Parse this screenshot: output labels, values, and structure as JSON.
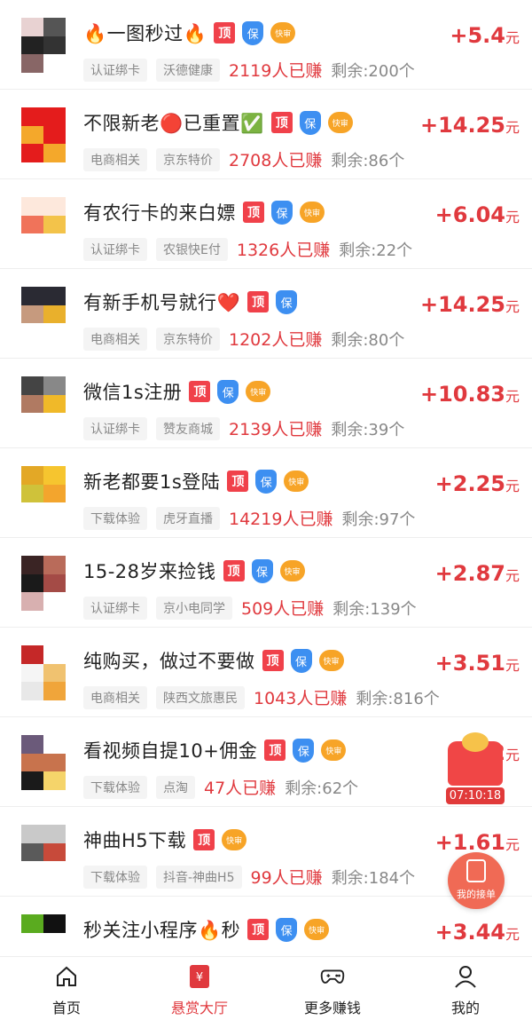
{
  "tasks": [
    {
      "title": "🔥一图秒过🔥",
      "badges": [
        "top",
        "bao",
        "fast"
      ],
      "tag1": "认证绑卡",
      "tag2": "沃德健康",
      "earned": "2119人已赚",
      "remain": "剩余:200个",
      "price": "+5.4",
      "thumb": [
        "#e8d2d2",
        "#555",
        "#222",
        "#333",
        "#866",
        "#fff"
      ]
    },
    {
      "title": "不限新老🔴已重置✅",
      "badges": [
        "top",
        "bao",
        "fast"
      ],
      "tag1": "电商相关",
      "tag2": "京东特价",
      "earned": "2708人已赚",
      "remain": "剩余:86个",
      "price": "+14.25",
      "thumb": [
        "#e41c1c",
        "#e41c1c",
        "#f4a82b",
        "#e41c1c",
        "#e41c1c",
        "#f4a82b"
      ]
    },
    {
      "title": "有农行卡的来白嫖",
      "badges": [
        "top",
        "bao",
        "fast"
      ],
      "tag1": "认证绑卡",
      "tag2": "农银快E付",
      "earned": "1326人已赚",
      "remain": "剩余:22个",
      "price": "+6.04",
      "thumb": [
        "#fde8dc",
        "#fde8dc",
        "#f0735a",
        "#f3c34a",
        "#fff",
        "#fff"
      ]
    },
    {
      "title": "有新手机号就行❤️",
      "badges": [
        "top",
        "bao"
      ],
      "tag1": "电商相关",
      "tag2": "京东特价",
      "earned": "1202人已赚",
      "remain": "剩余:80个",
      "price": "+14.25",
      "thumb": [
        "#2a2a33",
        "#2a2a33",
        "#c69a7e",
        "#e9b02c",
        "#fff",
        "#fff"
      ]
    },
    {
      "title": "微信1s注册",
      "badges": [
        "top",
        "bao",
        "fast"
      ],
      "tag1": "认证绑卡",
      "tag2": "赞友商城",
      "earned": "2139人已赚",
      "remain": "剩余:39个",
      "price": "+10.83",
      "thumb": [
        "#444",
        "#888",
        "#b07a62",
        "#f0b929",
        "#fff",
        "#fff"
      ]
    },
    {
      "title": "新老都要1s登陆",
      "badges": [
        "top",
        "bao",
        "fast"
      ],
      "tag1": "下载体验",
      "tag2": "虎牙直播",
      "earned": "14219人已赚",
      "remain": "剩余:97个",
      "price": "+2.25",
      "thumb": [
        "#e3a826",
        "#f6c52f",
        "#cfc23a",
        "#f3a52d",
        "#fff",
        "#fff"
      ]
    },
    {
      "title": "15-28岁来捡钱",
      "badges": [
        "top",
        "bao",
        "fast"
      ],
      "tag1": "认证绑卡",
      "tag2": "京小电同学",
      "earned": "509人已赚",
      "remain": "剩余:139个",
      "price": "+2.87",
      "thumb": [
        "#3a2424",
        "#b96b5a",
        "#1a1a1a",
        "#a44b46",
        "#d8b0b0",
        "#fff"
      ]
    },
    {
      "title": "纯购买，做过不要做",
      "badges": [
        "top",
        "bao",
        "fast"
      ],
      "tag1": "电商相关",
      "tag2": "陕西文旅惠民",
      "earned": "1043人已赚",
      "remain": "剩余:816个",
      "price": "+3.51",
      "thumb": [
        "#c52828",
        "#fff",
        "#f5f5f5",
        "#f0c270",
        "#e8e8e8",
        "#f0a53a"
      ]
    },
    {
      "title": "看视频自提10+佣金",
      "badges": [
        "top",
        "bao",
        "fast"
      ],
      "tag1": "下载体验",
      "tag2": "点淘",
      "earned": "47人已赚",
      "remain": "剩余:62个",
      "price": "+2",
      "thumb": [
        "#6b5a7a",
        "#fff",
        "#c8734d",
        "#c8734d",
        "#1a1a1a",
        "#f5d46a"
      ]
    },
    {
      "title": "神曲H5下载",
      "badges": [
        "top",
        "fast"
      ],
      "tag1": "下载体验",
      "tag2": "抖音-神曲H5",
      "earned": "99人已赚",
      "remain": "剩余:184个",
      "price": "+1.61",
      "thumb": [
        "#c9c9c9",
        "#c9c9c9",
        "#5a5a5a",
        "#c74a3a",
        "#fff",
        "#fff"
      ]
    },
    {
      "title": "秒关注小程序🔥秒",
      "badges": [
        "top",
        "bao",
        "fast"
      ],
      "tag1": "",
      "tag2": "",
      "earned": "",
      "remain": "",
      "price": "+3.44",
      "thumb": [
        "#5aab1f",
        "#111",
        "#fff",
        "#fff",
        "#fff",
        "#fff"
      ]
    }
  ],
  "badge_text": {
    "top": "顶",
    "bao": "保",
    "fast": "快审"
  },
  "price_unit": "元",
  "floating": {
    "timer": "07:10:18",
    "my_orders": "我的接单"
  },
  "nav": [
    {
      "icon": "home-icon",
      "label": "首页"
    },
    {
      "icon": "bounty-hall-icon",
      "label": "悬赏大厅",
      "active": true
    },
    {
      "icon": "gamepad-icon",
      "label": "更多赚钱"
    },
    {
      "icon": "user-icon",
      "label": "我的"
    }
  ],
  "colors": {
    "accent": "#e0393e",
    "top_badge": "#f0414a",
    "bao_badge": "#3d8ff1",
    "fast_badge": "#f7a427"
  }
}
